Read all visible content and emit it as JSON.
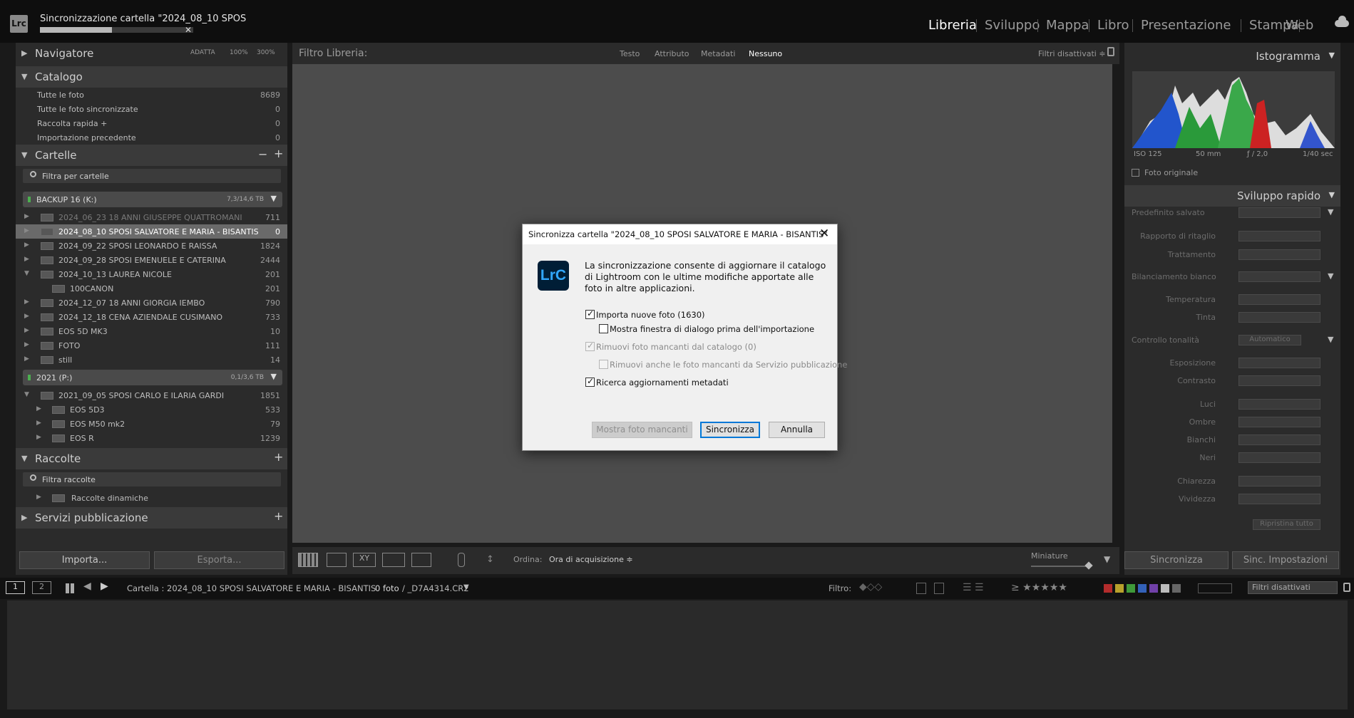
{
  "app": {
    "logo_text": "Lrc",
    "sync_status": "Sincronizzazione cartella \"2024_08_10 SPOS",
    "sync_progress": 0.47,
    "sync_cancel": "✕"
  },
  "modules": [
    "Libreria",
    "Sviluppo",
    "Mappa",
    "Libro",
    "Presentazione",
    "Stampa",
    "Web"
  ],
  "active_module": "Libreria",
  "left": {
    "navigator": {
      "title": "Navigatore",
      "fit": "ADATTA",
      "zoom1": "100%",
      "zoom2": "300%"
    },
    "catalog": {
      "title": "Catalogo",
      "items": [
        {
          "label": "Tutte le foto",
          "count": "8689"
        },
        {
          "label": "Tutte le foto sincronizzate",
          "count": "0"
        },
        {
          "label": "Raccolta rapida +",
          "count": "0"
        },
        {
          "label": "Importazione precedente",
          "count": "0"
        }
      ]
    },
    "folders": {
      "title": "Cartelle",
      "minus": "−",
      "plus": "+",
      "filter_placeholder": "Filtra per cartelle",
      "volume1": {
        "name": "BACKUP 16 (K:)",
        "size": "7,3/14,6 TB"
      },
      "volume1_items": [
        {
          "label": "2024_06_23 18 ANNI GIUSEPPE QUATTROMANI",
          "count": "711"
        },
        {
          "label": "2024_08_10 SPOSI SALVATORE E MARIA - BISANTIS",
          "count": "0"
        },
        {
          "label": "2024_09_22 SPOSI LEONARDO E RAISSA",
          "count": "1824"
        },
        {
          "label": "2024_09_28 SPOSI EMENUELE E CATERINA",
          "count": "2444"
        },
        {
          "label": "2024_10_13 LAUREA NICOLE",
          "count": "201"
        },
        {
          "label": "100CANON",
          "count": "201"
        },
        {
          "label": "2024_12_07 18 ANNI GIORGIA IEMBO",
          "count": "790"
        },
        {
          "label": "2024_12_18 CENA AZIENDALE CUSIMANO",
          "count": "733"
        },
        {
          "label": "EOS 5D MK3",
          "count": "10"
        },
        {
          "label": "FOTO",
          "count": "111"
        },
        {
          "label": "still",
          "count": "14"
        }
      ],
      "volume2": {
        "name": "2021 (P:)",
        "size": "0,1/3,6 TB"
      },
      "volume2_items": [
        {
          "label": "2021_09_05 SPOSI CARLO E ILARIA GARDI",
          "count": "1851"
        },
        {
          "label": "EOS 5D3",
          "count": "533"
        },
        {
          "label": "EOS M50 mk2",
          "count": "79"
        },
        {
          "label": "EOS R",
          "count": "1239"
        }
      ]
    },
    "collections": {
      "title": "Raccolte",
      "plus": "+",
      "filter_placeholder": "Filtra raccolte",
      "item": "Raccolte dinamiche"
    },
    "publish": {
      "title": "Servizi pubblicazione",
      "plus": "+"
    },
    "import_label": "Importa...",
    "export_label": "Esporta..."
  },
  "filter_bar": {
    "label": "Filtro Libreria:",
    "tabs": [
      "Testo",
      "Attributo",
      "Metadati",
      "Nessuno"
    ],
    "active_tab": "Nessuno",
    "right": "Filtri disattivati ≑"
  },
  "toolbar": {
    "sort_label": "Ordina:",
    "sort_value": "Ora di acquisizione ≑",
    "thumbs_label": "Miniature"
  },
  "right": {
    "histogram": {
      "title": "Istogramma",
      "iso": "ISO 125",
      "focal": "50 mm",
      "aperture": "ƒ / 2,0",
      "shutter": "1/40 sec",
      "original": "Foto originale"
    },
    "quick_develop": {
      "title": "Sviluppo rapido",
      "saved_preset": "Predefinito salvato",
      "crop_ratio": "Rapporto di ritaglio",
      "treatment": "Trattamento",
      "white_balance": "Bilanciamento bianco",
      "temperature": "Temperatura",
      "tint": "Tinta",
      "tone_control": "Controllo tonalità",
      "auto": "Automatico",
      "exposure": "Esposizione",
      "contrast": "Contrasto",
      "highlights": "Luci",
      "shadows": "Ombre",
      "whites": "Bianchi",
      "blacks": "Neri",
      "clarity": "Chiarezza",
      "vibrance": "Vividezza",
      "reset": "Ripristina tutto"
    },
    "sync_label": "Sincronizza",
    "sync_settings_label": "Sinc. Impostazioni"
  },
  "filmstrip_bar": {
    "view1": "1",
    "view2": "2",
    "path": "Cartella : 2024_08_10 SPOSI SALVATORE E MARIA - BISANTIS",
    "photos": "0 foto",
    "filename": "/ _D7A4314.CR2",
    "filter_label": "Filtro:",
    "filter_value": "Filtri disattivati"
  },
  "dialog": {
    "title": "Sincronizza cartella \"2024_08_10 SPOSI SALVATORE E MARIA - BISANTIS\"",
    "logo": "LrC",
    "message": "La sincronizzazione consente di aggiornare il catalogo di Lightroom con le ultime modifiche apportate alle foto in altre applicazioni.",
    "opt_import": "Importa nuove foto (1630)",
    "opt_show_dialog": "Mostra finestra di dialogo prima dell'importazione",
    "opt_remove": "Rimuovi foto mancanti dal catalogo (0)",
    "opt_remove_publish": "Rimuovi anche le foto mancanti da Servizio pubblicazione",
    "opt_metadata": "Ricerca aggiornamenti metadati",
    "btn_show_missing": "Mostra foto mancanti",
    "btn_sync": "Sincronizza",
    "btn_cancel": "Annulla"
  }
}
